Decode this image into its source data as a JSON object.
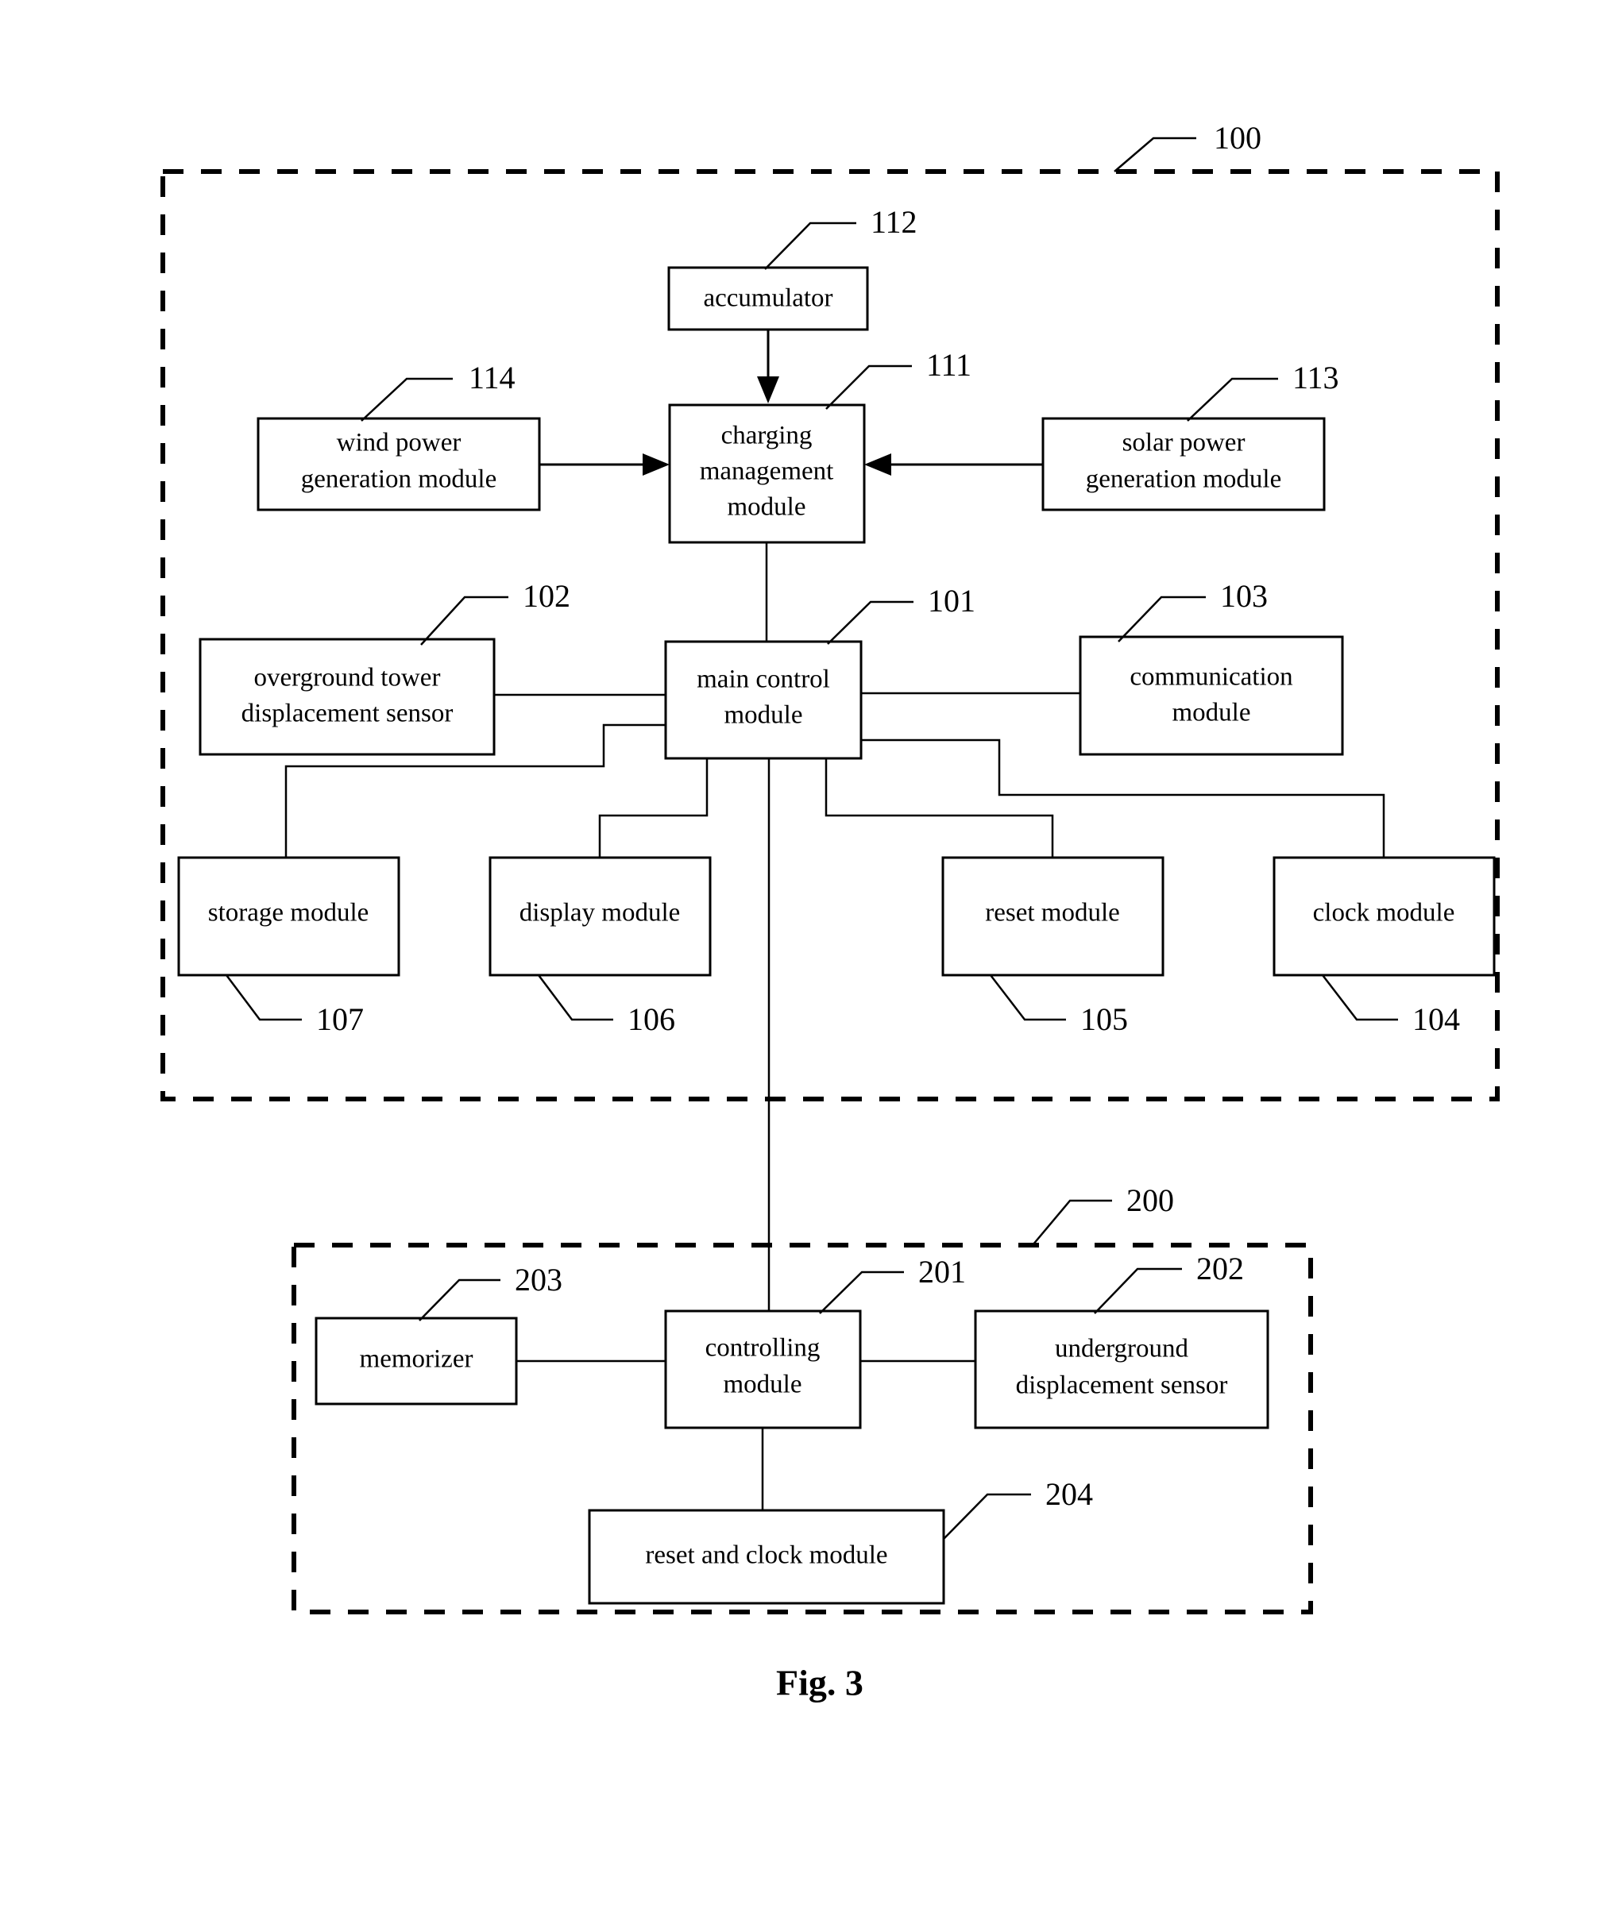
{
  "figure": {
    "caption": "Fig. 3"
  },
  "groups": [
    {
      "id": "group-100",
      "ref": "100"
    },
    {
      "id": "group-200",
      "ref": "200"
    }
  ],
  "blocks": [
    {
      "id": "accumulator",
      "label_lines": [
        "accumulator"
      ],
      "ref": "112"
    },
    {
      "id": "charging-management",
      "label_lines": [
        "charging",
        "management",
        "module"
      ],
      "ref": "111"
    },
    {
      "id": "wind-power-generation",
      "label_lines": [
        "wind power",
        "generation module"
      ],
      "ref": "114"
    },
    {
      "id": "solar-power-generation",
      "label_lines": [
        "solar power",
        "generation module"
      ],
      "ref": "113"
    },
    {
      "id": "overground-tower-sensor",
      "label_lines": [
        "overground tower",
        "displacement sensor"
      ],
      "ref": "102"
    },
    {
      "id": "main-control",
      "label_lines": [
        "main control",
        "module"
      ],
      "ref": "101"
    },
    {
      "id": "communication",
      "label_lines": [
        "communication",
        "module"
      ],
      "ref": "103"
    },
    {
      "id": "storage",
      "label_lines": [
        "storage module"
      ],
      "ref": "107"
    },
    {
      "id": "display",
      "label_lines": [
        "display module"
      ],
      "ref": "106"
    },
    {
      "id": "reset",
      "label_lines": [
        "reset module"
      ],
      "ref": "105"
    },
    {
      "id": "clock",
      "label_lines": [
        "clock module"
      ],
      "ref": "104"
    },
    {
      "id": "memorizer",
      "label_lines": [
        "memorizer"
      ],
      "ref": "203"
    },
    {
      "id": "controlling",
      "label_lines": [
        "controlling",
        "module"
      ],
      "ref": "201"
    },
    {
      "id": "underground-sensor",
      "label_lines": [
        "underground",
        "displacement sensor"
      ],
      "ref": "202"
    },
    {
      "id": "reset-and-clock",
      "label_lines": [
        "reset and clock module"
      ],
      "ref": "204"
    }
  ],
  "text": {
    "accumulator": "accumulator",
    "charging_l1": "charging",
    "charging_l2": "management",
    "charging_l3": "module",
    "wind_l1": "wind power",
    "wind_l2": "generation module",
    "solar_l1": "solar power",
    "solar_l2": "generation module",
    "overground_l1": "overground tower",
    "overground_l2": "displacement sensor",
    "main_control_l1": "main control",
    "main_control_l2": "module",
    "communication_l1": "communication",
    "communication_l2": "module",
    "storage": "storage module",
    "display": "display module",
    "reset": "reset module",
    "clock": "clock module",
    "memorizer": "memorizer",
    "controlling_l1": "controlling",
    "controlling_l2": "module",
    "underground_l1": "underground",
    "underground_l2": "displacement sensor",
    "reset_and_clock": "reset and clock module",
    "caption": "Fig. 3"
  },
  "refs": {
    "r100": "100",
    "r200": "200",
    "r101": "101",
    "r102": "102",
    "r103": "103",
    "r104": "104",
    "r105": "105",
    "r106": "106",
    "r107": "107",
    "r111": "111",
    "r112": "112",
    "r113": "113",
    "r114": "114",
    "r201": "201",
    "r202": "202",
    "r203": "203",
    "r204": "204"
  },
  "colors": {
    "stroke": "#000000",
    "fill": "#ffffff",
    "background": "#ffffff"
  }
}
